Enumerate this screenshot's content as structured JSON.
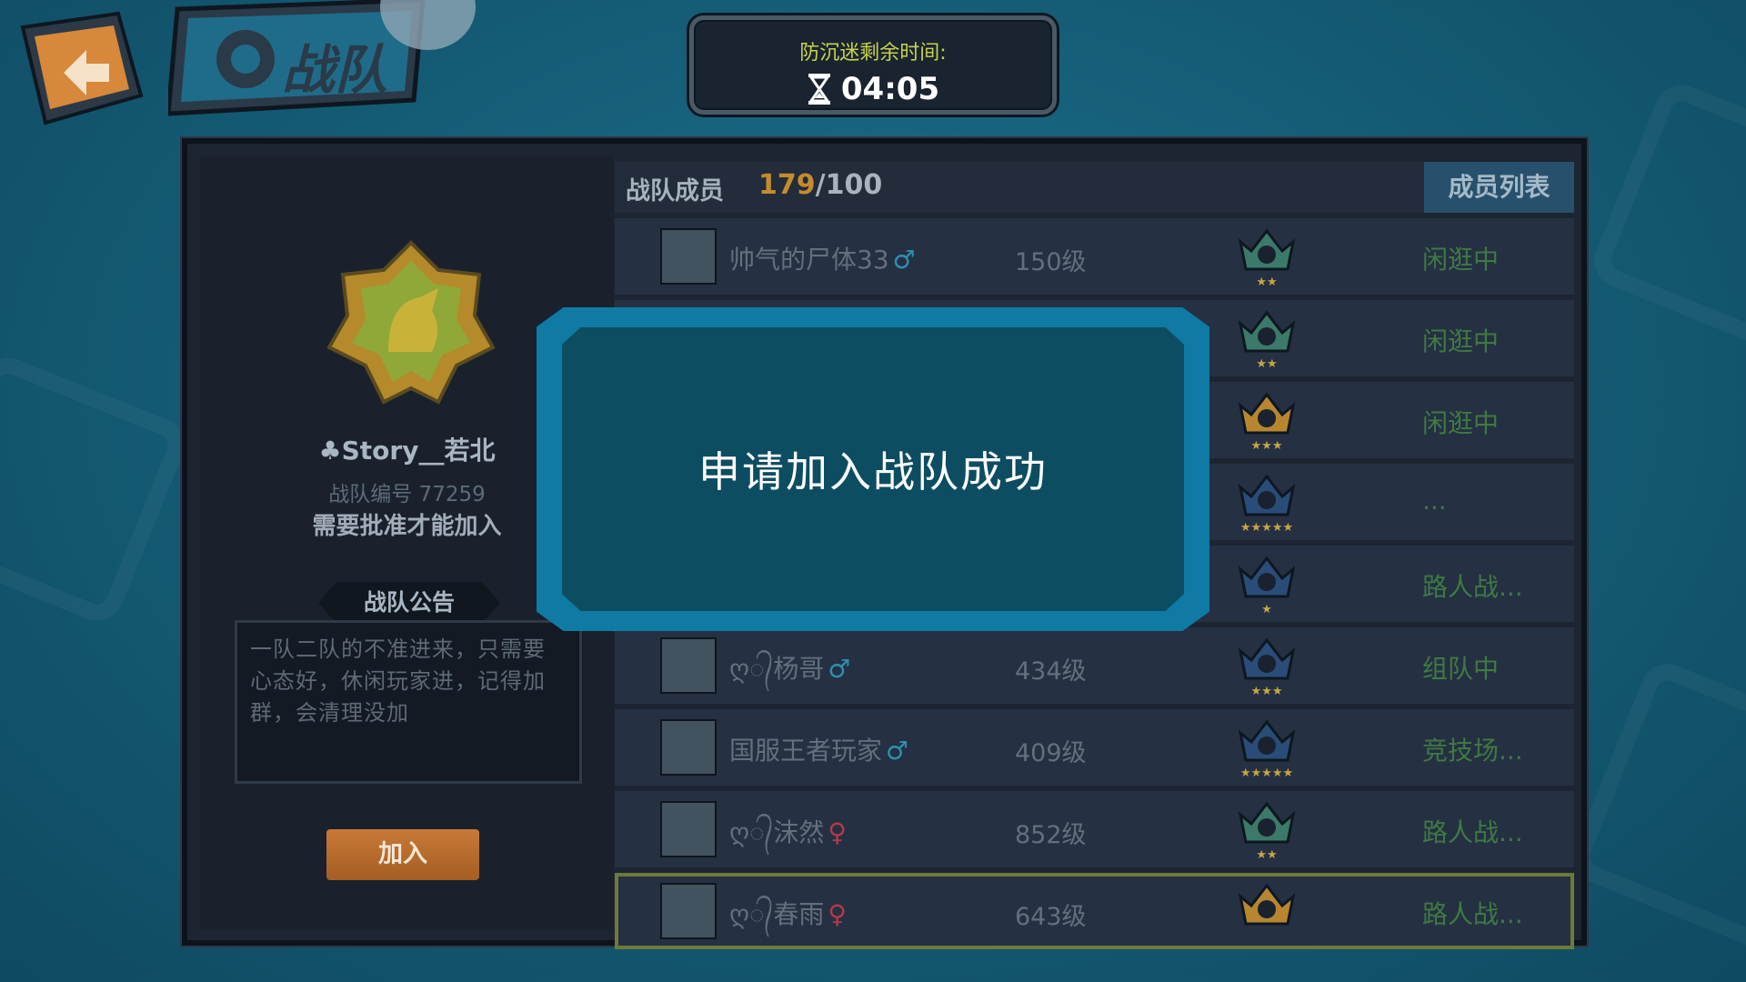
{
  "header": {
    "title": "战队"
  },
  "timer": {
    "label": "防沉迷剩余时间:",
    "value": "04:05"
  },
  "team": {
    "name": "♣Story__若北",
    "id_text": "战队编号 77259",
    "requirement": "需要批准才能加入",
    "notice_title": "战队公告",
    "notice_text": "一队二队的不准进来，只需要心态好，休闲玩家进，记得加群，会清理没加",
    "join_label": "加入"
  },
  "members_header": {
    "title": "战队成员",
    "count_current": "179",
    "count_sep": "/",
    "count_max": "100",
    "tab_label": "成员列表"
  },
  "members": [
    {
      "name": "帅气的尸体33",
      "gender": "♂",
      "level": "150级",
      "rank_color": "#3b7a6a",
      "stars": "★★",
      "status": "闲逛中"
    },
    {
      "name": "",
      "gender": "",
      "level": "",
      "rank_color": "#3b7a6a",
      "stars": "★★",
      "status": "闲逛中"
    },
    {
      "name": "",
      "gender": "",
      "level": "",
      "rank_color": "#b7862f",
      "stars": "★★★",
      "status": "闲逛中"
    },
    {
      "name": "",
      "gender": "",
      "level": "",
      "rank_color": "#2a4c78",
      "stars": "★★★★★",
      "status": "..."
    },
    {
      "name": "",
      "gender": "",
      "level": "",
      "rank_color": "#2a4c78",
      "stars": "★",
      "status": "路人战..."
    },
    {
      "name": "ღ᭄杨哥",
      "gender": "♂",
      "level": "434级",
      "rank_color": "#2a4c78",
      "stars": "★★★",
      "status": "组队中"
    },
    {
      "name": "国服王者玩家",
      "gender": "♂",
      "level": "409级",
      "rank_color": "#2a4c78",
      "stars": "★★★★★",
      "status": "竞技场..."
    },
    {
      "name": "ღ᭄沫然",
      "gender": "♀",
      "level": "852级",
      "rank_color": "#3b7a6a",
      "stars": "★★",
      "status": "路人战..."
    },
    {
      "name": "ღ᭄春雨",
      "gender": "♀",
      "level": "643级",
      "rank_color": "#b7862f",
      "stars": "",
      "status": "路人战..."
    }
  ],
  "modal": {
    "message": "申请加入战队成功"
  }
}
